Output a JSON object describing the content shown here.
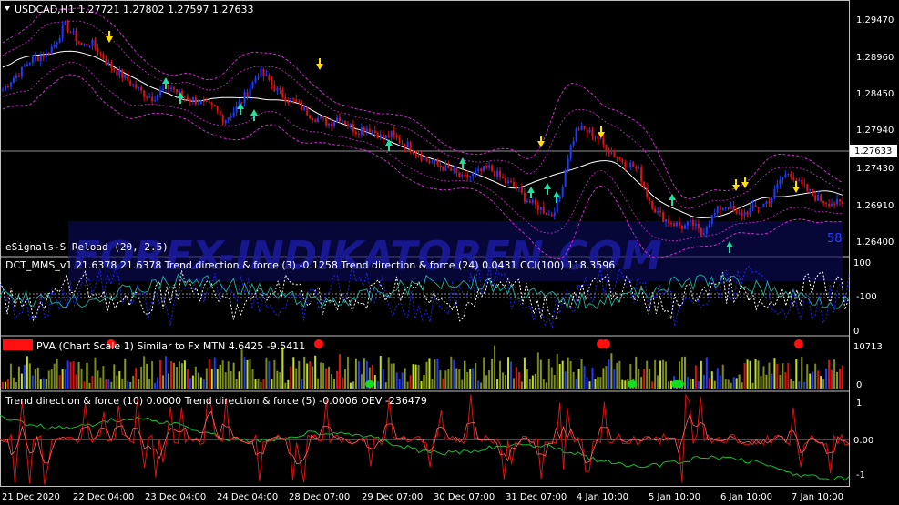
{
  "main": {
    "symbol_timeframe": "USDCAD,H1",
    "ohlc": "1.27721 1.27802 1.27597 1.27633",
    "current_price": "1.27633",
    "price_ticks": [
      "1.29470",
      "1.28960",
      "1.28450",
      "1.27940",
      "1.27430",
      "1.26910",
      "1.26400"
    ],
    "indicator_label": "eSignals-S Reload (20, 2.5)",
    "side_value": "58",
    "watermark": "FOREX-INDIKATOREN.COM"
  },
  "sub1": {
    "label": "DCT_MMS_v1 21.6378 21.6378  Trend direction & force (3) -0.1258  Trend direction & force (24) 0.0431  CCI(100) 118.3596",
    "ticks": [
      "100",
      "-100",
      "0"
    ]
  },
  "sub2": {
    "label": "PVA  (Chart Scale 1)   Similar to Fx MTN  4.6425 -9.5411",
    "ticks": [
      "10713",
      "0"
    ]
  },
  "sub3": {
    "label": "Trend direction & force (10) 0.0000  Trend direction & force (5) -0.0006  OEV -236479",
    "ticks": [
      "1",
      "0.00",
      "-1"
    ]
  },
  "time_axis": [
    "21 Dec 2020",
    "22 Dec 04:00",
    "23 Dec 04:00",
    "24 Dec 04:00",
    "28 Dec 07:00",
    "29 Dec 07:00",
    "30 Dec 07:00",
    "31 Dec 07:00",
    "4 Jan 10:00",
    "5 Jan 10:00",
    "6 Jan 10:00",
    "7 Jan 10:00"
  ],
  "colors": {
    "bull": "#1e3cff",
    "bear": "#e01010",
    "band": "#d02ad0",
    "mid": "#ffffff",
    "up_arrow": "#20e0a0",
    "down_arrow": "#ffe000",
    "grid": "#c0c0c0"
  },
  "chart_data": {
    "type": "candlestick",
    "symbol": "USDCAD",
    "timeframe": "H1",
    "last": 1.27633,
    "close_path": [
      1.2845,
      1.286,
      1.287,
      1.2885,
      1.289,
      1.2895,
      1.291,
      1.2935,
      1.292,
      1.2905,
      1.291,
      1.2895,
      1.288,
      1.287,
      1.286,
      1.285,
      1.284,
      1.2835,
      1.2845,
      1.285,
      1.284,
      1.2835,
      1.283,
      1.2825,
      1.282,
      1.2805,
      1.2815,
      1.283,
      1.285,
      1.287,
      1.286,
      1.2845,
      1.2835,
      1.283,
      1.282,
      1.281,
      1.2805,
      1.28,
      1.281,
      1.28,
      1.279,
      1.2795,
      1.279,
      1.278,
      1.2785,
      1.2775,
      1.277,
      1.276,
      1.275,
      1.2745,
      1.274,
      1.2735,
      1.2725,
      1.273,
      1.2735,
      1.274,
      1.273,
      1.272,
      1.2715,
      1.27,
      1.269,
      1.2685,
      1.2675,
      1.27,
      1.276,
      1.2795,
      1.279,
      1.2785,
      1.277,
      1.276,
      1.275,
      1.2745,
      1.2735,
      1.27,
      1.268,
      1.267,
      1.2665,
      1.266,
      1.2665,
      1.265,
      1.267,
      1.2685,
      1.269,
      1.2675,
      1.268,
      1.2685,
      1.269,
      1.27,
      1.2725,
      1.2735,
      1.272,
      1.271,
      1.27,
      1.2695,
      1.2693,
      1.269
    ],
    "ylim": [
      1.2625,
      1.296
    ]
  }
}
